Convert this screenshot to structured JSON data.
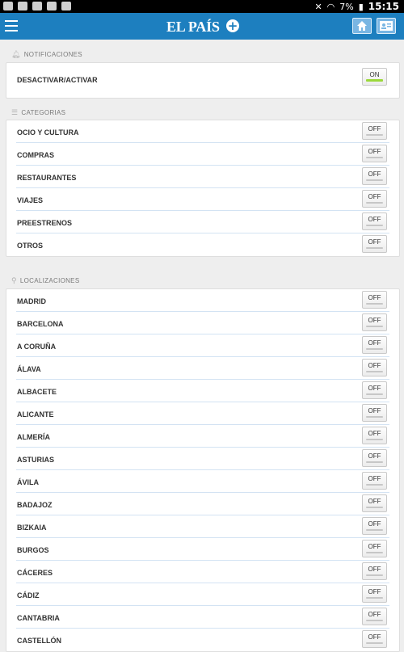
{
  "status_bar": {
    "battery": "7%",
    "time": "15:15"
  },
  "app_bar": {
    "title": "EL PAÍS",
    "plus": "+"
  },
  "sections": {
    "notificaciones": {
      "title": "NOTIFICACIONES",
      "rows": [
        {
          "label": "DESACTIVAR/ACTIVAR",
          "state": "ON"
        }
      ]
    },
    "categorias": {
      "title": "CATEGORIAS",
      "rows": [
        {
          "label": "OCIO Y CULTURA",
          "state": "OFF"
        },
        {
          "label": "COMPRAS",
          "state": "OFF"
        },
        {
          "label": "RESTAURANTES",
          "state": "OFF"
        },
        {
          "label": "VIAJES",
          "state": "OFF"
        },
        {
          "label": "PREESTRENOS",
          "state": "OFF"
        },
        {
          "label": "OTROS",
          "state": "OFF"
        }
      ]
    },
    "localizaciones": {
      "title": "LOCALIZACIONES",
      "rows": [
        {
          "label": "MADRID",
          "state": "OFF"
        },
        {
          "label": "BARCELONA",
          "state": "OFF"
        },
        {
          "label": "A CORUÑA",
          "state": "OFF"
        },
        {
          "label": "ÁLAVA",
          "state": "OFF"
        },
        {
          "label": "ALBACETE",
          "state": "OFF"
        },
        {
          "label": "ALICANTE",
          "state": "OFF"
        },
        {
          "label": "ALMERÍA",
          "state": "OFF"
        },
        {
          "label": "ASTURIAS",
          "state": "OFF"
        },
        {
          "label": "ÁVILA",
          "state": "OFF"
        },
        {
          "label": "BADAJOZ",
          "state": "OFF"
        },
        {
          "label": "BIZKAIA",
          "state": "OFF"
        },
        {
          "label": "BURGOS",
          "state": "OFF"
        },
        {
          "label": "CÁCERES",
          "state": "OFF"
        },
        {
          "label": "CÁDIZ",
          "state": "OFF"
        },
        {
          "label": "CANTABRIA",
          "state": "OFF"
        },
        {
          "label": "CASTELLÓN",
          "state": "OFF"
        }
      ]
    }
  }
}
